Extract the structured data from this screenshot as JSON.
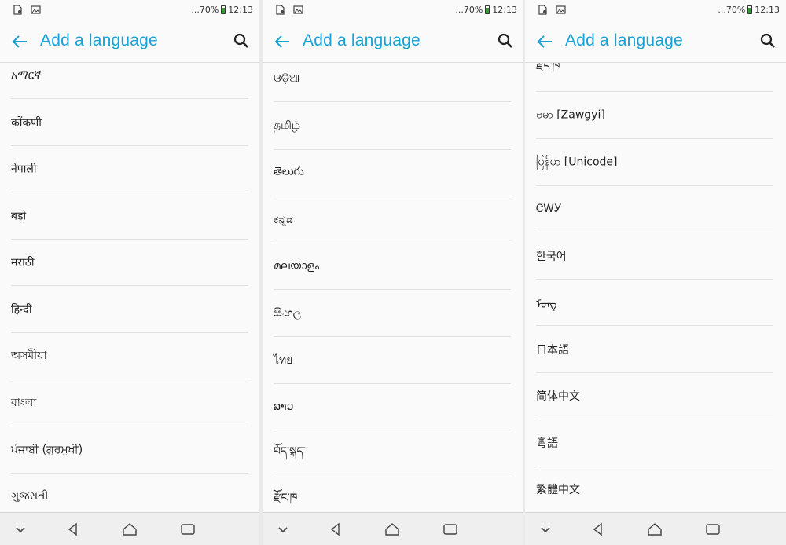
{
  "status": {
    "battery": "...70%",
    "time": "12:13"
  },
  "toolbar": {
    "title": "Add a language"
  },
  "panels": [
    {
      "items": [
        "አማርኛ",
        "कोंकणी",
        "नेपाली",
        "बड़ो",
        "मराठी",
        "हिन्दी",
        "অসমীয়া",
        "বাংলা",
        "ਪੰਜਾਬੀ (ਗੁਰਮੁਖੀ)",
        "ગુજરાતી"
      ]
    },
    {
      "items": [
        "ଓଡ଼ିଆ",
        "தமிழ்",
        "తెలుగు",
        "ಕನ್ನಡ",
        "മലയാളം",
        "සිංහල",
        "ไทย",
        "ລາວ",
        "བོད་སྐད་",
        "རྫོང་ཁ"
      ]
    },
    {
      "items": [
        "རྫོང་ཁ",
        "ဗမာ [Zawgyi]",
        "မြန်မာ [Unicode]",
        "ᏣᎳᎩ",
        "한국어",
        "ᠮᠣᠩ",
        "日本語",
        "简体中文",
        "粵語",
        "繁體中文"
      ]
    }
  ]
}
